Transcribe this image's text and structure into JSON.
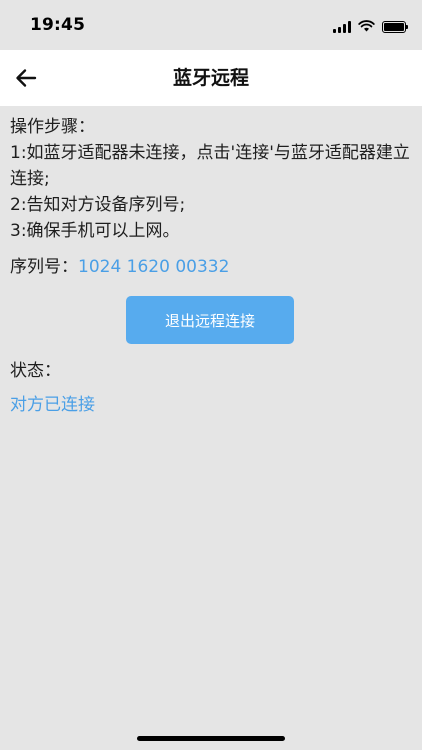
{
  "status_bar": {
    "time": "19:45",
    "icons": [
      "signal-icon",
      "wifi-icon",
      "battery-icon"
    ]
  },
  "header": {
    "back_icon": "arrow-left-icon",
    "title": "蓝牙远程"
  },
  "instructions": {
    "heading": "操作步骤：",
    "steps": [
      "1:如蓝牙适配器未连接，点击'连接'与蓝牙适配器建立连接;",
      "2:告知对方设备序列号;",
      "3:确保手机可以上网。"
    ]
  },
  "serial": {
    "label": "序列号：",
    "value": "1024 1620 00332"
  },
  "actions": {
    "exit_remote_label": "退出远程连接"
  },
  "connection_status": {
    "label": "状态：",
    "value": "对方已连接"
  },
  "colors": {
    "accent": "#57abee",
    "link_text": "#4a9fe6",
    "background": "#e5e5e5",
    "header_background": "#ffffff"
  }
}
